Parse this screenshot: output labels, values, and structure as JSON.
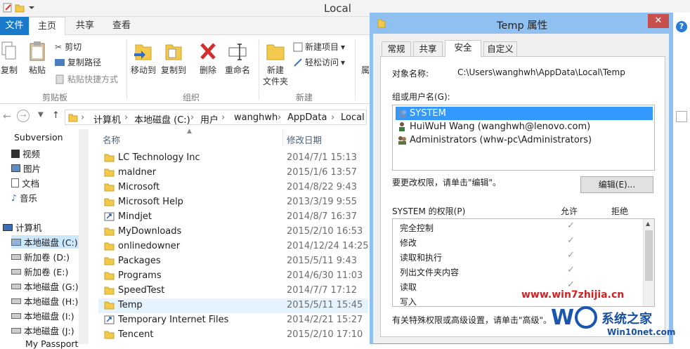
{
  "window": {
    "title": "Local"
  },
  "ribbon": {
    "tabs": [
      "文件",
      "主页",
      "共享",
      "查看"
    ],
    "clipboard": {
      "copy": "复制",
      "paste": "粘贴",
      "cut": "剪切",
      "copy_path": "复制路径",
      "paste_shortcut": "粘贴快捷方式",
      "group": "剪贴板"
    },
    "organize": {
      "move_to": "移动到",
      "copy_to": "复制到",
      "delete": "删除",
      "rename": "重命名",
      "group": "组织"
    },
    "new": {
      "new_folder": "新建",
      "new_folder2": "文件夹",
      "new_item": "新建项目",
      "easy_access": "轻松访问",
      "group": "新建"
    },
    "open_partial": "属"
  },
  "address": {
    "crumbs": [
      "计算机",
      "本地磁盘 (C:)",
      "用户",
      "wanghwh",
      "AppData",
      "Local"
    ]
  },
  "nav": {
    "items": [
      "Subversion",
      "视频",
      "图片",
      "文档",
      "音乐",
      "计算机",
      "本地磁盘 (C:)",
      "新加卷 (D:)",
      "新加卷 (E:)",
      "本地磁盘 (G:)",
      "本地磁盘 (H:)",
      "本地磁盘 (I:)",
      "本地磁盘 (J:)",
      "My Passport"
    ]
  },
  "list": {
    "col_name": "名称",
    "col_date": "修改日期",
    "rows": [
      {
        "name": "LC Technology Inc",
        "date": "2014/7/1 15:13"
      },
      {
        "name": "maldner",
        "date": "2015/1/6 13:57"
      },
      {
        "name": "Microsoft",
        "date": "2014/8/22 9:43"
      },
      {
        "name": "Microsoft Help",
        "date": "2013/3/19 9:55"
      },
      {
        "name": "Mindjet",
        "date": "2014/8/7 16:37"
      },
      {
        "name": "MyDownloads",
        "date": "2015/2/10 16:53"
      },
      {
        "name": "onlinedowner",
        "date": "2014/12/24 14:25"
      },
      {
        "name": "Packages",
        "date": "2015/5/11 9:43"
      },
      {
        "name": "Programs",
        "date": "2014/6/30 11:03"
      },
      {
        "name": "SpeedTest",
        "date": "2014/7/7 17:12"
      },
      {
        "name": "Temp",
        "date": "2015/5/11 15:45"
      },
      {
        "name": "Temporary Internet Files",
        "date": "2014/2/21 15:27"
      },
      {
        "name": "Tencent",
        "date": "2015/2/10 17:10"
      }
    ]
  },
  "dialog": {
    "title": "Temp 属性",
    "close": "✕",
    "tabs": [
      "常规",
      "共享",
      "安全",
      "自定义"
    ],
    "object_label": "对象名称:",
    "object_value": "C:\\Users\\wanghwh\\AppData\\Local\\Temp",
    "group_label": "组或用户名(G):",
    "users": [
      "SYSTEM",
      "HuiWuH Wang (wanghwh@lenovo.com)",
      "Administrators (whw-pc\\Administrators)"
    ],
    "change_hint": "要更改权限，请单击\"编辑\"。",
    "edit_button": "编辑(E)...",
    "perm_label": "SYSTEM 的权限(P)",
    "allow": "允许",
    "deny": "拒绝",
    "permissions": [
      "完全控制",
      "修改",
      "读取和执行",
      "列出文件夹内容",
      "读取",
      "写入"
    ],
    "check": "✓",
    "advanced_hint": "有关特殊权限或高级设置，请单击\"高级\"。"
  },
  "watermark": {
    "top": "www.win7zhijia.cn",
    "brand": "系统之家",
    "url": "Win10net.com"
  },
  "colors": {
    "accent": "#1979ca",
    "selection": "#3399ff",
    "dialog_frame": "#8fc0ef",
    "close": "#c7504c"
  }
}
